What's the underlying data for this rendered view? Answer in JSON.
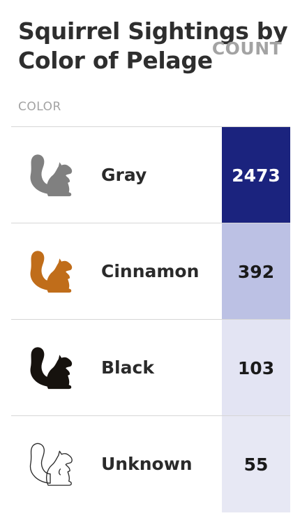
{
  "title": "Squirrel Sightings by Color of Pelage",
  "headers": {
    "color": "COLOR",
    "count": "COUNT"
  },
  "chart_data": {
    "type": "table",
    "title": "Squirrel Sightings by Color of Pelage",
    "columns": [
      "COLOR",
      "COUNT"
    ],
    "rows": [
      {
        "label": "Gray",
        "value": 2473,
        "icon": "squirrel-icon",
        "icon_color": "#808080",
        "cell_color": "#1b237e",
        "text_color": "#ffffff"
      },
      {
        "label": "Cinnamon",
        "value": 392,
        "icon": "squirrel-icon",
        "icon_color": "#c06d1a",
        "cell_color": "#bcc1e4",
        "text_color": "#1a1a1a"
      },
      {
        "label": "Black",
        "value": 103,
        "icon": "squirrel-icon",
        "icon_color": "#16120e",
        "cell_color": "#e3e4f3",
        "text_color": "#1a1a1a"
      },
      {
        "label": "Unknown",
        "value": 55,
        "icon": "squirrel-outline-icon",
        "icon_color": "#2a2a2a",
        "cell_color": "#e7e8f4",
        "text_color": "#1a1a1a"
      }
    ]
  }
}
